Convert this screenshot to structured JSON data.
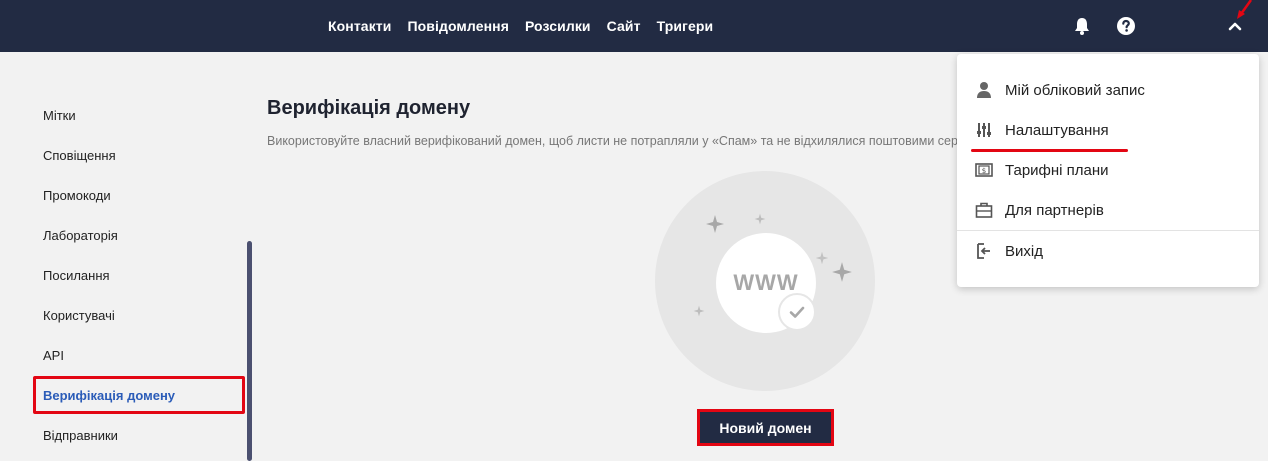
{
  "topnav": {
    "items": [
      "Контакти",
      "Повідомлення",
      "Розсилки",
      "Сайт",
      "Тригери"
    ]
  },
  "sidebar": {
    "items": [
      {
        "label": "Мітки"
      },
      {
        "label": "Сповіщення"
      },
      {
        "label": "Промокоди"
      },
      {
        "label": "Лабораторія"
      },
      {
        "label": "Посилання"
      },
      {
        "label": "Користувачі"
      },
      {
        "label": "API"
      },
      {
        "label": "Верифікація домену",
        "active": true
      },
      {
        "label": "Відправники"
      }
    ]
  },
  "main": {
    "title": "Верифікація домену",
    "description": "Використовуйте власний верифікований домен, щоб листи не потрапляли у «Спам» та не відхилялися поштовими сервісами.",
    "illustration_text": "WWW",
    "new_domain_label": "Новий домен"
  },
  "user_menu": {
    "items": [
      {
        "label": "Мій обліковий запис",
        "icon": "user-icon"
      },
      {
        "label": "Налаштування",
        "icon": "sliders-icon"
      },
      {
        "label": "Тарифні плани",
        "icon": "banknote-icon"
      },
      {
        "label": "Для партнерів",
        "icon": "briefcase-icon"
      },
      {
        "label": "Вихід",
        "icon": "logout-icon"
      }
    ]
  },
  "colors": {
    "topbar": "#222b43",
    "active_link": "#2b5cb8",
    "highlight": "#e30613"
  }
}
